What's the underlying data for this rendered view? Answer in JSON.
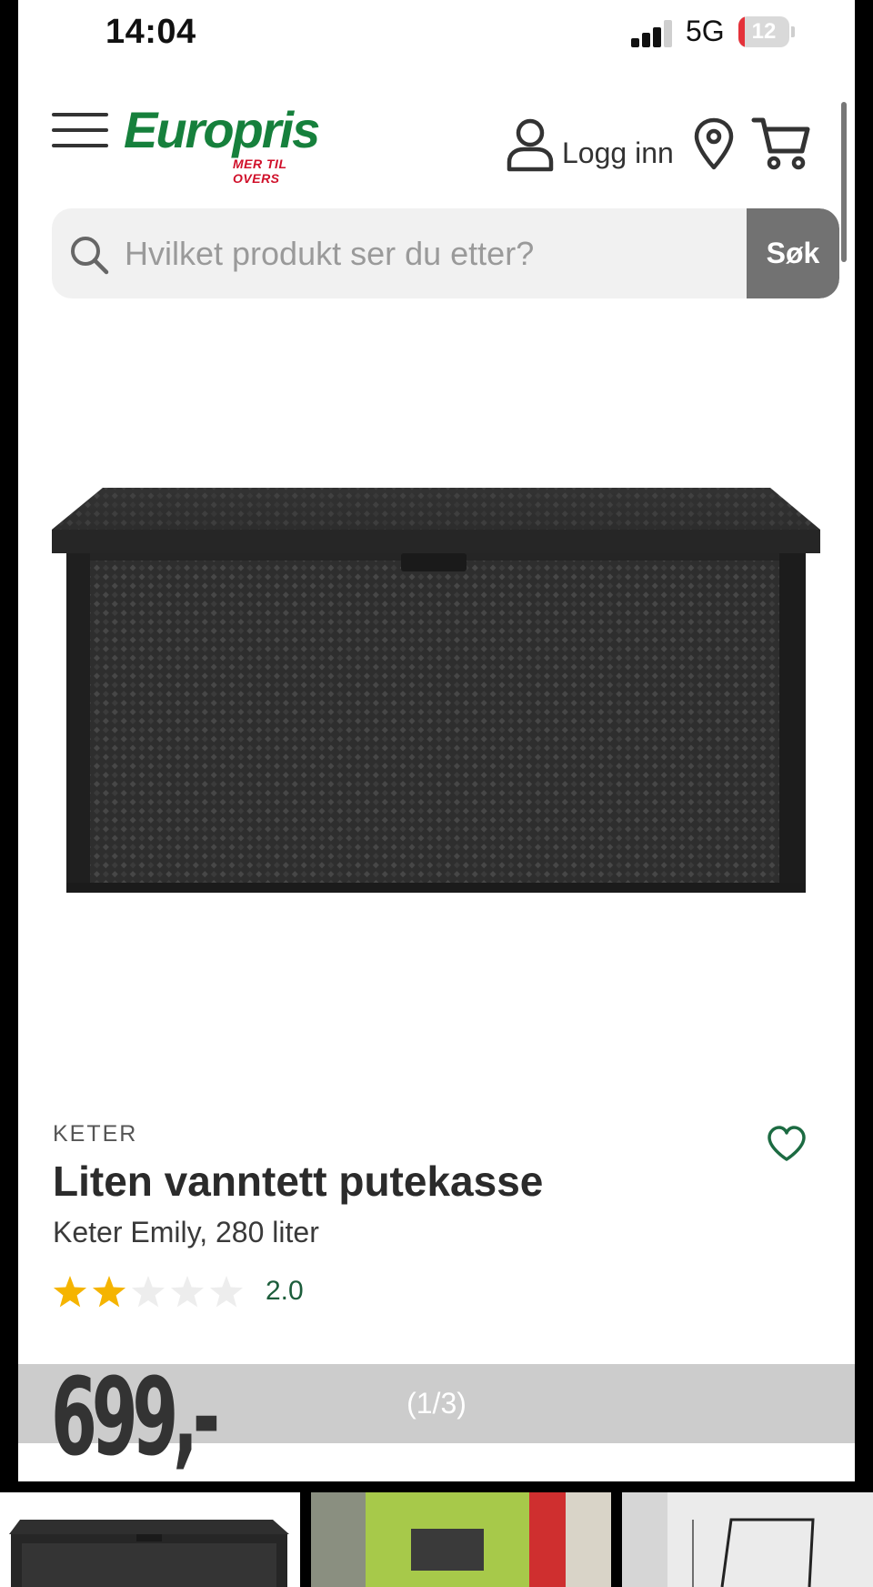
{
  "status_bar": {
    "time": "14:04",
    "network": "5G",
    "battery": "12",
    "battery_level": 0.12
  },
  "header": {
    "logo": "Europris",
    "logo_tagline": "MER TIL OVERS",
    "login_label": "Logg inn"
  },
  "search": {
    "placeholder": "Hvilket produkt ser du etter?",
    "button_label": "Søk"
  },
  "product": {
    "brand": "KETER",
    "title": "Liten vanntett putekasse",
    "subtitle": "Keter Emily, 280 liter",
    "rating": 2.0,
    "rating_label": "2.0",
    "rating_max": 5,
    "price": "699,-"
  },
  "gallery": {
    "counter": "(1/3)"
  },
  "colors": {
    "brand_green": "#16803c",
    "brand_red": "#d0102a",
    "star_filled": "#f5b400",
    "star_empty": "#ededed",
    "rating_text": "#1c5d3b"
  },
  "icons": {
    "menu": "hamburger-icon",
    "user": "user-icon",
    "location": "map-pin-icon",
    "cart": "shopping-cart-icon",
    "search": "search-icon",
    "favorite": "heart-icon",
    "star": "star-icon"
  }
}
